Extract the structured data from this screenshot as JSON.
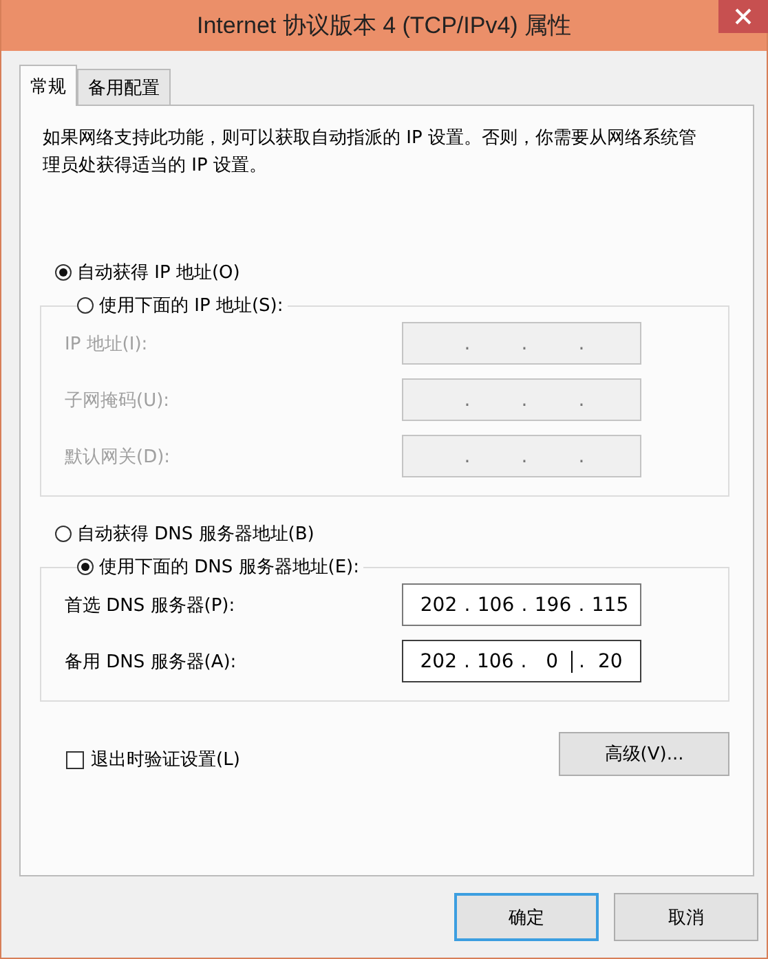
{
  "window": {
    "title": "Internet 协议版本 4 (TCP/IPv4) 属性"
  },
  "tabs": [
    {
      "label": "常规",
      "selected": true
    },
    {
      "label": "备用配置",
      "selected": false
    }
  ],
  "description": "如果网络支持此功能，则可以获取自动指派的 IP 设置。否则，你需要从网络系统管理员处获得适当的 IP 设置。",
  "sections": [
    {
      "options": [
        {
          "label": "自动获得 IP 地址(O)",
          "selected": true
        },
        {
          "label": "使用下面的 IP 地址(S):",
          "selected": false
        }
      ],
      "disabled": true,
      "fields": [
        {
          "label": "IP 地址(I):",
          "dots": [
            ".",
            ".",
            "."
          ],
          "focused": false
        },
        {
          "label": "子网掩码(U):",
          "dots": [
            ".",
            ".",
            "."
          ],
          "focused": false
        },
        {
          "label": "默认网关(D):",
          "dots": [
            ".",
            ".",
            "."
          ],
          "focused": false
        }
      ]
    },
    {
      "options": [
        {
          "label": "自动获得 DNS 服务器地址(B)",
          "selected": false
        },
        {
          "label": "使用下面的 DNS 服务器地址(E):",
          "selected": true
        }
      ],
      "disabled": false,
      "fields": [
        {
          "label": "首选 DNS 服务器(P):",
          "dots": [
            ".",
            ".",
            "."
          ],
          "octets": [
            "202",
            "106",
            "196",
            "115"
          ],
          "focused": false
        },
        {
          "label": "备用 DNS 服务器(A):",
          "dots": [
            ".",
            ".",
            "."
          ],
          "octets": [
            "202",
            "106",
            "0",
            "20"
          ],
          "focused": true
        }
      ]
    }
  ],
  "validate_checkbox": {
    "label": "退出时验证设置(L)",
    "checked": false
  },
  "advanced_button": "高级(V)...",
  "buttons": [
    {
      "label": "确定",
      "default": true
    },
    {
      "label": "取消",
      "default": false
    }
  ]
}
